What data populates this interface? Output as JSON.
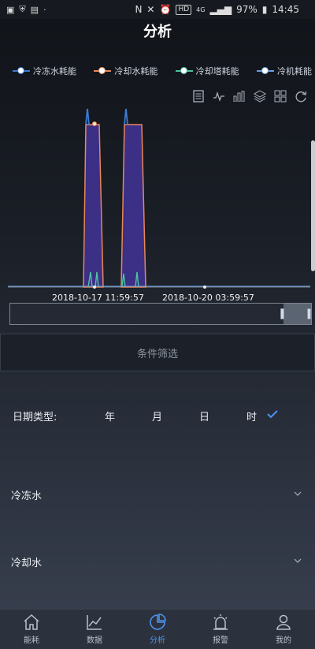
{
  "status": {
    "signal": "4G",
    "battery": "97%",
    "time": "14:45",
    "hd": "HD"
  },
  "header": {
    "title": "分析"
  },
  "legend": [
    {
      "label": "冷冻水耗能",
      "color": "#3a7bd5"
    },
    {
      "label": "冷却水耗能",
      "color": "#e8875a"
    },
    {
      "label": "冷却塔耗能",
      "color": "#4fc3a1"
    },
    {
      "label": "冷机耗能",
      "color": "#6aa0e0"
    }
  ],
  "chart_data": {
    "type": "area",
    "x_start": "2018-10-17 11:59:57",
    "x_end": "2018-10-20 03:59:57",
    "x_tick_labels": [
      "2018-10-17 11:59:57",
      "2018-10-20 03:59:57"
    ],
    "zoom_window": [
      0.9,
      1.0
    ]
  },
  "filter": {
    "label": "条件筛选"
  },
  "date_type": {
    "label": "日期类型:",
    "options": [
      "年",
      "月",
      "日",
      "时"
    ],
    "selected": "时"
  },
  "sections": [
    {
      "label": "冷冻水"
    },
    {
      "label": "冷却水"
    }
  ],
  "tabs": [
    {
      "label": "能耗",
      "icon": "home-icon"
    },
    {
      "label": "数据",
      "icon": "chart-line-icon"
    },
    {
      "label": "分析",
      "icon": "pie-chart-icon",
      "active": true
    },
    {
      "label": "报警",
      "icon": "alarm-icon"
    },
    {
      "label": "我的",
      "icon": "user-icon"
    }
  ]
}
